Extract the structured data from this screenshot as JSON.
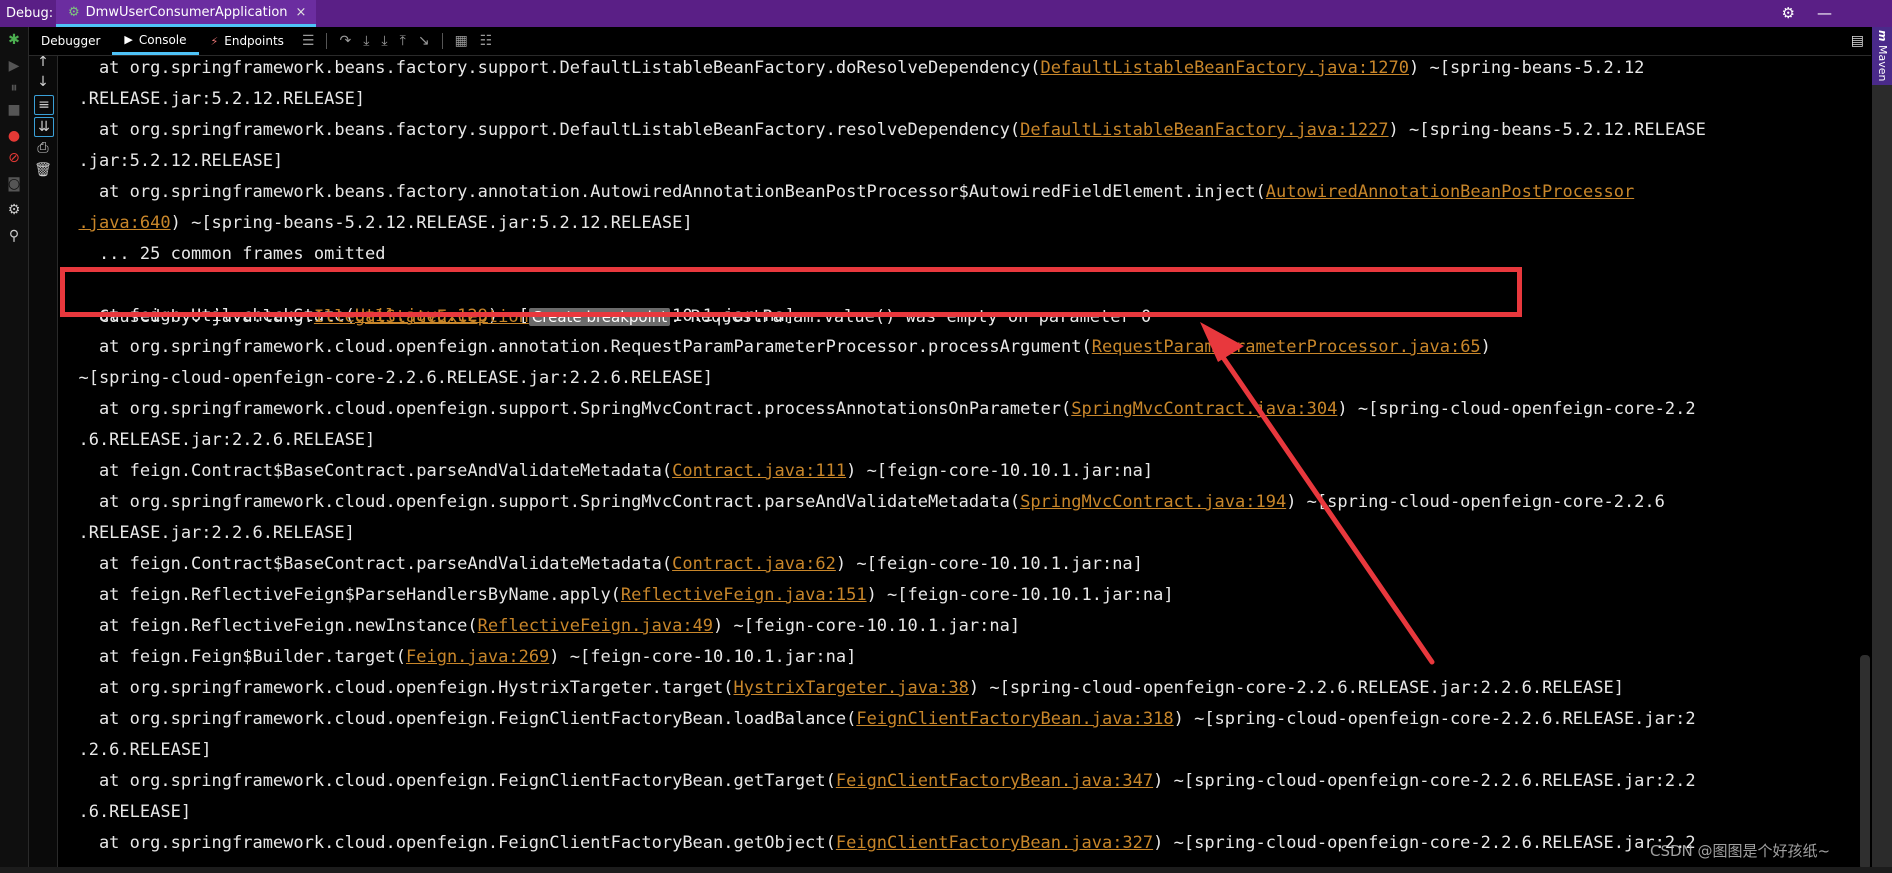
{
  "titlebar": {
    "debug_label": "Debug:",
    "run_config": "DmwUserConsumerApplication",
    "close": "×"
  },
  "tabs": [
    {
      "label": "Debugger"
    },
    {
      "label": "Console"
    },
    {
      "label": "Endpoints"
    }
  ],
  "maven": {
    "m": "m",
    "label": "Maven"
  },
  "console": {
    "lines": [
      {
        "text": "    at org.springframework.beans.factory.support.DefaultListableBeanFactory.doResolveDependency(",
        "link": "DefaultListableBeanFactory.java:1270",
        "tail": ") ~[spring-beans-5.2.12"
      },
      {
        "text": "  .RELEASE.jar:5.2.12.RELEASE]",
        "link": "",
        "tail": ""
      },
      {
        "text": "    at org.springframework.beans.factory.support.DefaultListableBeanFactory.resolveDependency(",
        "link": "DefaultListableBeanFactory.java:1227",
        "tail": ") ~[spring-beans-5.2.12.RELEASE"
      },
      {
        "text": "  .jar:5.2.12.RELEASE]",
        "link": "",
        "tail": ""
      },
      {
        "text": "    at org.springframework.beans.factory.annotation.AutowiredAnnotationBeanPostProcessor$AutowiredFieldElement.inject(",
        "link": "AutowiredAnnotationBeanPostProcessor",
        "tail": ""
      },
      {
        "text": "  ",
        "link": ".java:640",
        "tail": ") ~[spring-beans-5.2.12.RELEASE.jar:5.2.12.RELEASE]"
      },
      {
        "text": "    ... 25 common frames omitted",
        "link": "",
        "tail": ""
      },
      {
        "text": "",
        "link": "",
        "tail": ""
      },
      {
        "text": "    at feign.Util.checkState(",
        "link": "Util.java:129",
        "tail": ") ~[feign-core-10.10.1.jar:na]"
      },
      {
        "text": "    at org.springframework.cloud.openfeign.annotation.RequestParamParameterProcessor.processArgument(",
        "link": "RequestParamParameterProcessor.java:65",
        "tail": ")"
      },
      {
        "text": "  ~[spring-cloud-openfeign-core-2.2.6.RELEASE.jar:2.2.6.RELEASE]",
        "link": "",
        "tail": ""
      },
      {
        "text": "    at org.springframework.cloud.openfeign.support.SpringMvcContract.processAnnotationsOnParameter(",
        "link": "SpringMvcContract.java:304",
        "tail": ") ~[spring-cloud-openfeign-core-2.2"
      },
      {
        "text": "  .6.RELEASE.jar:2.2.6.RELEASE]",
        "link": "",
        "tail": ""
      },
      {
        "text": "    at feign.Contract$BaseContract.parseAndValidateMetadata(",
        "link": "Contract.java:111",
        "tail": ") ~[feign-core-10.10.1.jar:na]"
      },
      {
        "text": "    at org.springframework.cloud.openfeign.support.SpringMvcContract.parseAndValidateMetadata(",
        "link": "SpringMvcContract.java:194",
        "tail": ") ~[spring-cloud-openfeign-core-2.2.6"
      },
      {
        "text": "  .RELEASE.jar:2.2.6.RELEASE]",
        "link": "",
        "tail": ""
      },
      {
        "text": "    at feign.Contract$BaseContract.parseAndValidateMetadata(",
        "link": "Contract.java:62",
        "tail": ") ~[feign-core-10.10.1.jar:na]"
      },
      {
        "text": "    at feign.ReflectiveFeign$ParseHandlersByName.apply(",
        "link": "ReflectiveFeign.java:151",
        "tail": ") ~[feign-core-10.10.1.jar:na]"
      },
      {
        "text": "    at feign.ReflectiveFeign.newInstance(",
        "link": "ReflectiveFeign.java:49",
        "tail": ") ~[feign-core-10.10.1.jar:na]"
      },
      {
        "text": "    at feign.Feign$Builder.target(",
        "link": "Feign.java:269",
        "tail": ") ~[feign-core-10.10.1.jar:na]"
      },
      {
        "text": "    at org.springframework.cloud.openfeign.HystrixTargeter.target(",
        "link": "HystrixTargeter.java:38",
        "tail": ") ~[spring-cloud-openfeign-core-2.2.6.RELEASE.jar:2.2.6.RELEASE]"
      },
      {
        "text": "    at org.springframework.cloud.openfeign.FeignClientFactoryBean.loadBalance(",
        "link": "FeignClientFactoryBean.java:318",
        "tail": ") ~[spring-cloud-openfeign-core-2.2.6.RELEASE.jar:2"
      },
      {
        "text": "  .2.6.RELEASE]",
        "link": "",
        "tail": ""
      },
      {
        "text": "    at org.springframework.cloud.openfeign.FeignClientFactoryBean.getTarget(",
        "link": "FeignClientFactoryBean.java:347",
        "tail": ") ~[spring-cloud-openfeign-core-2.2.6.RELEASE.jar:2.2"
      },
      {
        "text": "  .6.RELEASE]",
        "link": "",
        "tail": ""
      },
      {
        "text": "    at org.springframework.cloud.openfeign.FeignClientFactoryBean.getObject(",
        "link": "FeignClientFactoryBean.java:327",
        "tail": ") ~[spring-cloud-openfeign-core-2.2.6.RELEASE.jar:2.2"
      }
    ],
    "caused_by": {
      "prefix": "Caused by: java.lang.",
      "exception_link": "IllegalStateException",
      "badge": "Create breakpoint",
      "message": ": RequestParam.value() was empty on parameter 0"
    }
  },
  "watermark": "CSDN @图图是个好孩纸~",
  "colors": {
    "title_bg": "#5a1f86",
    "link": "#c8862a",
    "highlight": "#e8383d",
    "accent": "#4fc3f7"
  }
}
